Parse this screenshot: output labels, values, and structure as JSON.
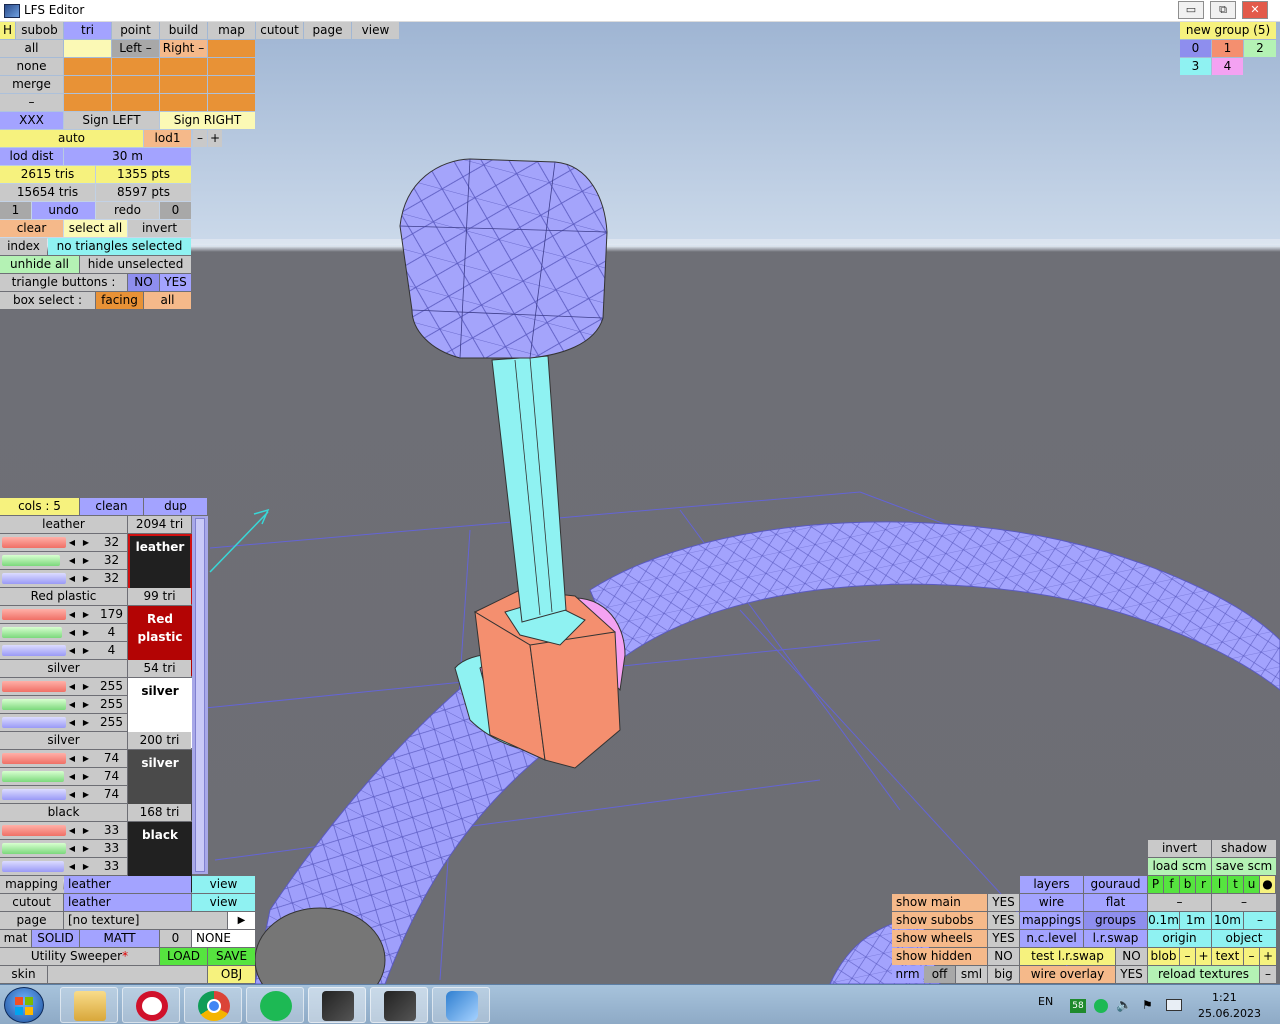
{
  "window": {
    "title": "LFS Editor",
    "minimize": "▭",
    "restore": "⧉",
    "close": "✕"
  },
  "topbar": {
    "h": "H",
    "tabs": [
      "subob",
      "tri",
      "point",
      "build",
      "map",
      "cutout",
      "page",
      "view"
    ]
  },
  "select_rows": {
    "all": "all",
    "none": "none",
    "merge": "merge",
    "dash": "–",
    "left": "Left –",
    "right": "Right –"
  },
  "sign": {
    "xxx": "XXX",
    "left": "Sign LEFT",
    "right": "Sign RIGHT"
  },
  "lod": {
    "auto": "auto",
    "lod1": "lod1",
    "minus": "–",
    "plus": "+",
    "dist_label": "lod dist",
    "dist_value": "30 m"
  },
  "stats": {
    "tris_a": "2615 tris",
    "pts_a": "1355 pts",
    "tris_b": "15654 tris",
    "pts_b": "8597 pts"
  },
  "undo_row": {
    "count_left": "1",
    "undo": "undo",
    "redo": "redo",
    "count_right": "0"
  },
  "tri_ops": {
    "clear": "clear",
    "select_all": "select all",
    "invert": "invert",
    "index": "index",
    "no_sel": "no triangles selected",
    "unhide_all": "unhide all",
    "hide_unselected": "hide unselected",
    "tri_buttons": "triangle buttons :",
    "no": "NO",
    "yes": "YES",
    "box_select": "box select :",
    "facing": "facing",
    "all": "all"
  },
  "groups": {
    "label": "new group (5)",
    "items": [
      "0",
      "1",
      "2",
      "3",
      "4"
    ]
  },
  "materials": {
    "header": {
      "cols": "cols : 5",
      "clean": "clean",
      "dup": "dup"
    },
    "list": [
      {
        "name": "leather",
        "tris": "2094 tri",
        "r": "32",
        "g": "32",
        "b": "32",
        "swatch": "leather",
        "bg": "#202020",
        "fg": "#ffffff",
        "border": "#d01010"
      },
      {
        "name": "Red plastic",
        "tris": "99 tri",
        "r": "179",
        "g": "4",
        "b": "4",
        "swatch": "Red plastic",
        "bg": "#b30404",
        "fg": "#ffffff",
        "border": "#b30404"
      },
      {
        "name": "silver",
        "tris": "54 tri",
        "r": "255",
        "g": "255",
        "b": "255",
        "swatch": "silver",
        "bg": "#ffffff",
        "fg": "#000000",
        "border": "#ffffff"
      },
      {
        "name": "silver",
        "tris": "200 tri",
        "r": "74",
        "g": "74",
        "b": "74",
        "swatch": "silver",
        "bg": "#4a4a4a",
        "fg": "#ffffff",
        "border": "#4a4a4a"
      },
      {
        "name": "black",
        "tris": "168 tri",
        "r": "33",
        "g": "33",
        "b": "33",
        "swatch": "black",
        "bg": "#212121",
        "fg": "#ffffff",
        "border": "#212121"
      }
    ]
  },
  "bottom_left": {
    "mapping": "mapping",
    "mapping_val": "leather",
    "view": "view",
    "cutout": "cutout",
    "cutout_val": "leather",
    "page": "page",
    "page_val": "[no texture]",
    "page_arrow": "▶",
    "mat": "mat",
    "solid": "SOLID",
    "matt": "MATT",
    "zero": "0",
    "none": "NONE",
    "util": "Utility Sweeper",
    "star": "*",
    "load": "LOAD",
    "save": "SAVE",
    "skin": "skin",
    "obj": "OBJ"
  },
  "bottom_right": {
    "invert": "invert",
    "shadow": "shadow",
    "load_scm": "load scm",
    "save_scm": "save scm",
    "pfb": [
      "P",
      "f",
      "b",
      "r",
      "l",
      "t",
      "u",
      "●"
    ],
    "layers": "layers",
    "gouraud": "gouraud",
    "wire": "wire",
    "flat": "flat",
    "dash": "–",
    "mappings": "mappings",
    "groups": "groups",
    "d01": "0.1m",
    "d1": "1m",
    "d10": "10m",
    "nclevel": "n.c.level",
    "lrswap": "l.r.swap",
    "origin": "origin",
    "object": "object",
    "test_lr": "test l.r.swap",
    "no": "NO",
    "blob": "blob",
    "minus": "–",
    "plus": "+",
    "text": "text",
    "wire_overlay": "wire overlay",
    "yes": "YES",
    "reload": "reload textures",
    "show_main": "show main",
    "show_subobs": "show subobs",
    "show_wheels": "show wheels",
    "show_hidden": "show hidden",
    "nrm": "nrm",
    "off": "off",
    "sml": "sml",
    "big": "big"
  },
  "taskbar": {
    "lang": "EN",
    "badge": "58",
    "time": "1:21",
    "date": "25.06.2023"
  }
}
